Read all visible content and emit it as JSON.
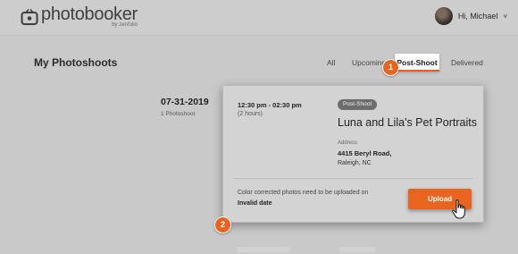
{
  "header": {
    "logo_name": "photobooker",
    "logo_sub": "by zenfolio",
    "greeting": "Hi, Michael",
    "chevron": "˅"
  },
  "page": {
    "title": "My Photoshoots"
  },
  "tabs": [
    {
      "label": "All",
      "active": false
    },
    {
      "label": "Upcoming",
      "active": false
    },
    {
      "label": "Post-Shoot",
      "active": true
    },
    {
      "label": "Delivered",
      "active": false
    }
  ],
  "badges": {
    "one": "1",
    "two": "2"
  },
  "group": {
    "date": "07-31-2019",
    "count": "1 Photoshoot"
  },
  "shoot": {
    "time": "12:30 pm - 02:30 pm",
    "duration": "(2 hours)",
    "status": "Post-Shoot",
    "title": "Luna and Lila's Pet Portraits",
    "address_label": "Address",
    "address_line1": "4415 Beryl Road,",
    "address_line2": "Raleigh, NC",
    "note": "Color corrected photos need to be uploaded on",
    "note_date": "Invalid date",
    "upload_label": "Upload"
  },
  "colors": {
    "accent": "#e8641f",
    "background": "#c9c9c9",
    "card": "#d3d3d3"
  },
  "icons": {
    "logo": "tv-camera-icon",
    "cursor": "hand-pointer-icon"
  }
}
